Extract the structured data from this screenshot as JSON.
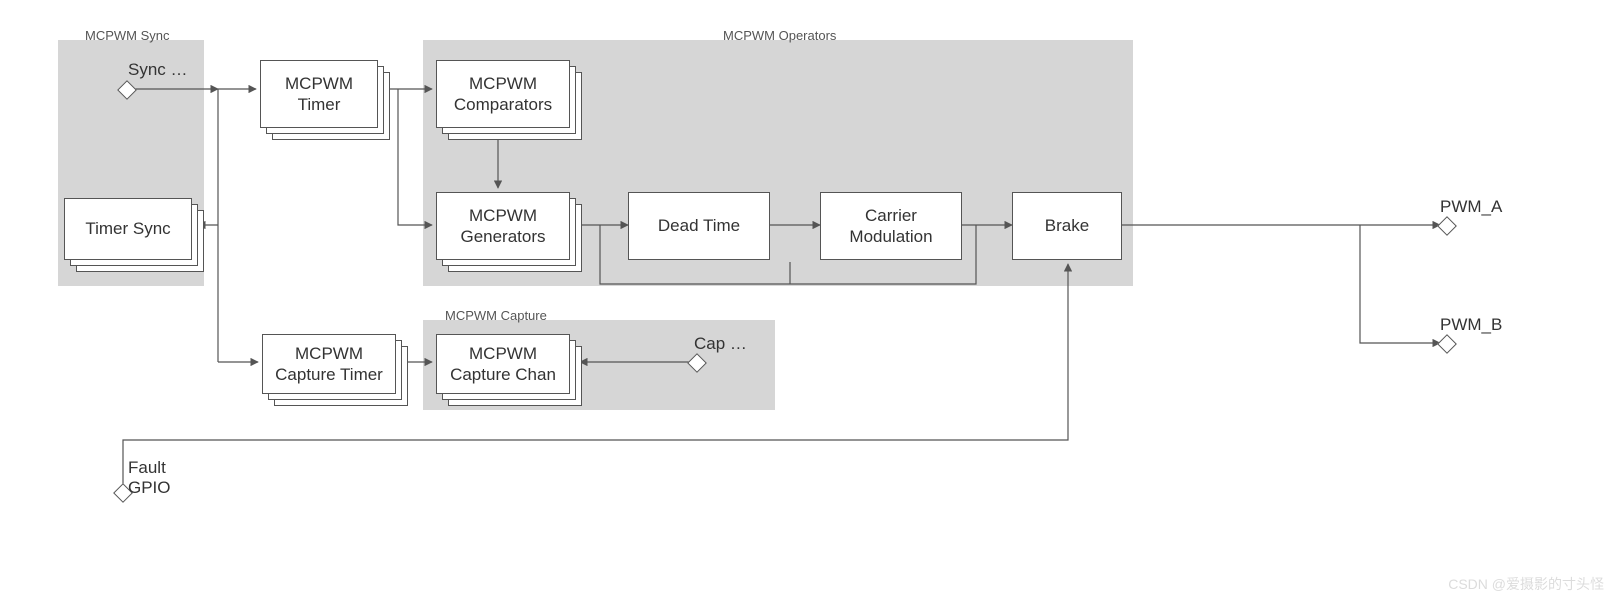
{
  "regions": {
    "sync": {
      "label": "MCPWM Sync"
    },
    "operators": {
      "label": "MCPWM Operators"
    },
    "capture": {
      "label": "MCPWM Capture"
    }
  },
  "blocks": {
    "timer_sync": {
      "label": "Timer Sync"
    },
    "timer": {
      "label": "MCPWM\nTimer"
    },
    "comparators": {
      "label": "MCPWM\nComparators"
    },
    "generators": {
      "label": "MCPWM\nGenerators"
    },
    "dead_time": {
      "label": "Dead Time"
    },
    "carrier": {
      "label": "Carrier\nModulation"
    },
    "brake": {
      "label": "Brake"
    },
    "cap_timer": {
      "label": "MCPWM\nCapture Timer"
    },
    "cap_chan": {
      "label": "MCPWM\nCapture Chan"
    }
  },
  "ports": {
    "sync": {
      "label": "Sync …"
    },
    "cap": {
      "label": "Cap …"
    },
    "fault": {
      "label": "Fault\nGPIO"
    },
    "pwm_a": {
      "label": "PWM_A"
    },
    "pwm_b": {
      "label": "PWM_B"
    }
  },
  "watermark": "CSDN @爱摄影的寸头怪"
}
